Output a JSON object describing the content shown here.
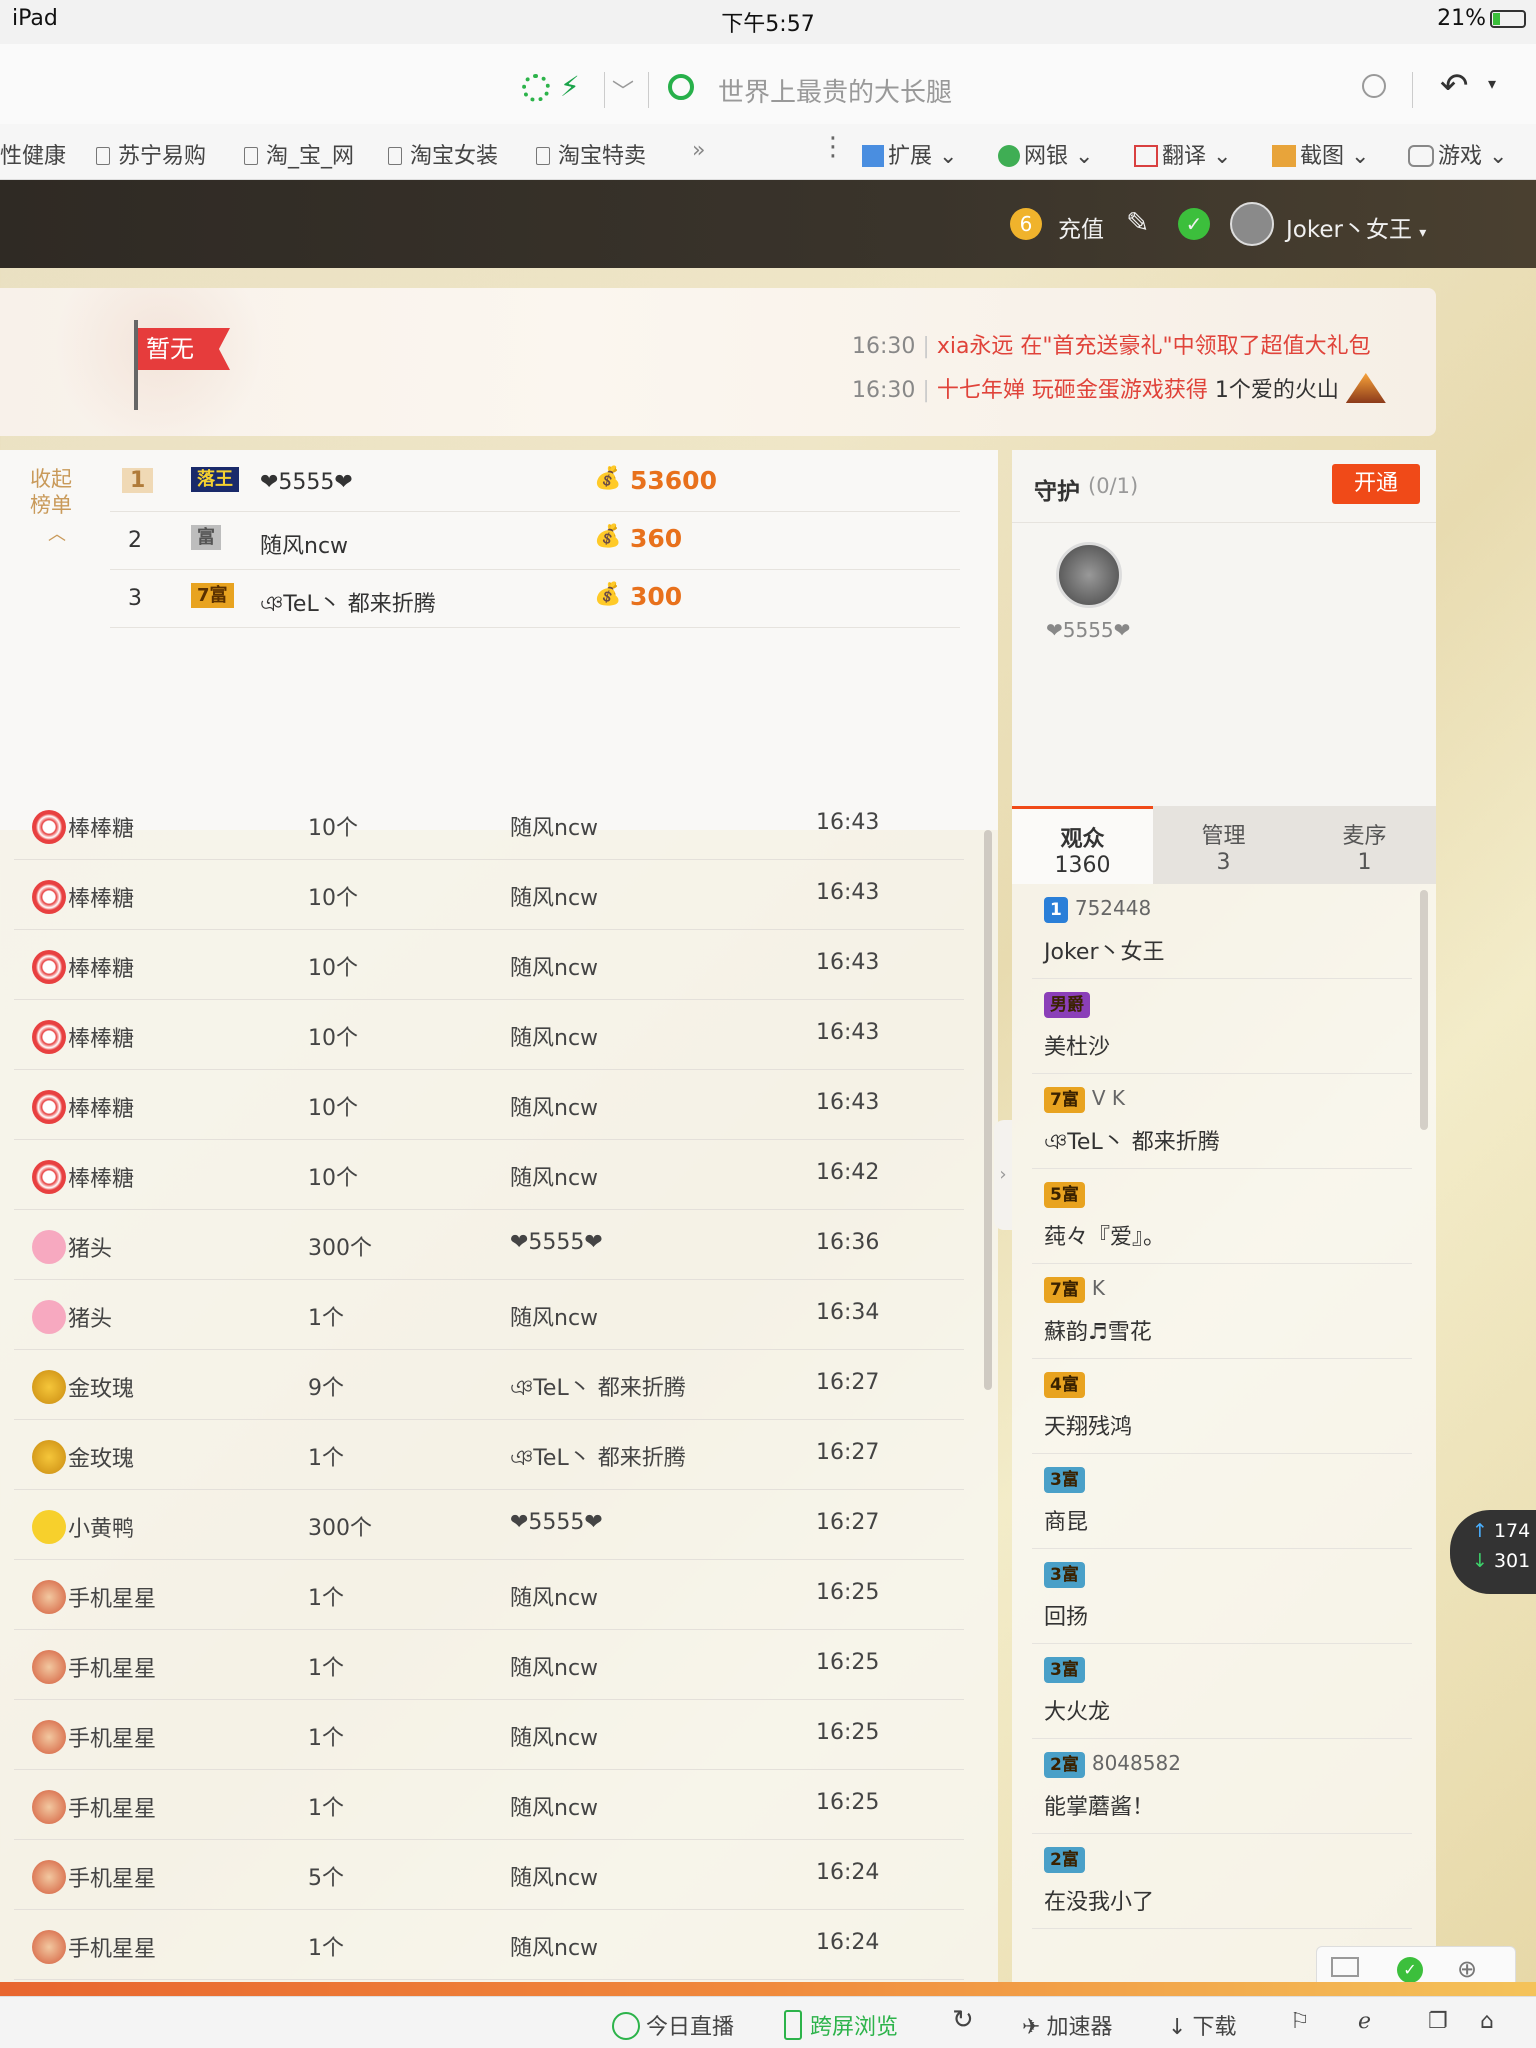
{
  "status": {
    "device": "iPad",
    "time": "下午5:57",
    "battery": "21%"
  },
  "browser": {
    "search_placeholder": "世界上最贵的大长腿",
    "bookmarks": [
      "性健康",
      "苏宁易购",
      "淘_宝_网",
      "淘宝女装",
      "淘宝特卖"
    ],
    "more": "»",
    "tools": [
      "扩展",
      "网银",
      "翻译",
      "截图",
      "游戏"
    ]
  },
  "site": {
    "recharge": "充值",
    "username": "Joker丶女王"
  },
  "banner": {
    "flag": "暂无",
    "notices": [
      {
        "time": "16:30",
        "text": "xia永远 在\"首充送豪礼\"中领取了超值大礼包"
      },
      {
        "time": "16:30",
        "user": "十七年婵",
        "text1": " 玩砸金蛋游戏获得 ",
        "text2": "1个爱的火山"
      }
    ]
  },
  "rank": {
    "collapse_label": "收起榜单",
    "rows": [
      {
        "rank": "1",
        "badge": "落王",
        "name": "❤5555❤",
        "coins": "53600"
      },
      {
        "rank": "2",
        "badge": "富",
        "name": "随风ncw",
        "coins": "360"
      },
      {
        "rank": "3",
        "badge": "7富",
        "name": "ঞTeL丶 都来折腾",
        "coins": "300"
      }
    ]
  },
  "gifts": [
    {
      "gift": "棒棒糖",
      "qty": "10个",
      "user": "随风ncw",
      "time": "16:43",
      "icon": "lollipop"
    },
    {
      "gift": "棒棒糖",
      "qty": "10个",
      "user": "随风ncw",
      "time": "16:43",
      "icon": "lollipop"
    },
    {
      "gift": "棒棒糖",
      "qty": "10个",
      "user": "随风ncw",
      "time": "16:43",
      "icon": "lollipop"
    },
    {
      "gift": "棒棒糖",
      "qty": "10个",
      "user": "随风ncw",
      "time": "16:43",
      "icon": "lollipop"
    },
    {
      "gift": "棒棒糖",
      "qty": "10个",
      "user": "随风ncw",
      "time": "16:43",
      "icon": "lollipop"
    },
    {
      "gift": "棒棒糖",
      "qty": "10个",
      "user": "随风ncw",
      "time": "16:42",
      "icon": "lollipop"
    },
    {
      "gift": "猪头",
      "qty": "300个",
      "user": "❤5555❤",
      "time": "16:36",
      "icon": "pig"
    },
    {
      "gift": "猪头",
      "qty": "1个",
      "user": "随风ncw",
      "time": "16:34",
      "icon": "pig"
    },
    {
      "gift": "金玫瑰",
      "qty": "9个",
      "user": "ঞTeL丶 都来折腾",
      "time": "16:27",
      "icon": "rose"
    },
    {
      "gift": "金玫瑰",
      "qty": "1个",
      "user": "ঞTeL丶 都来折腾",
      "time": "16:27",
      "icon": "rose"
    },
    {
      "gift": "小黄鸭",
      "qty": "300个",
      "user": "❤5555❤",
      "time": "16:27",
      "icon": "duck"
    },
    {
      "gift": "手机星星",
      "qty": "1个",
      "user": "随风ncw",
      "time": "16:25",
      "icon": "star"
    },
    {
      "gift": "手机星星",
      "qty": "1个",
      "user": "随风ncw",
      "time": "16:25",
      "icon": "star"
    },
    {
      "gift": "手机星星",
      "qty": "1个",
      "user": "随风ncw",
      "time": "16:25",
      "icon": "star"
    },
    {
      "gift": "手机星星",
      "qty": "1个",
      "user": "随风ncw",
      "time": "16:25",
      "icon": "star"
    },
    {
      "gift": "手机星星",
      "qty": "5个",
      "user": "随风ncw",
      "time": "16:24",
      "icon": "star"
    },
    {
      "gift": "手机星星",
      "qty": "1个",
      "user": "随风ncw",
      "time": "16:24",
      "icon": "star"
    }
  ],
  "guard": {
    "title": "守护",
    "count": "(0/1)",
    "open_button": "开通",
    "member": "❤5555❤"
  },
  "tabs": [
    {
      "label": "观众",
      "count": "1360"
    },
    {
      "label": "管理",
      "count": "3"
    },
    {
      "label": "麦序",
      "count": "1"
    }
  ],
  "audience": [
    {
      "badge": "1",
      "extra": "752448",
      "name": "Joker丶女王",
      "badge_color": "#2a7fd8"
    },
    {
      "badge": "男爵",
      "extra": "",
      "name": "美杜沙",
      "badge_color": "#8b3fb8"
    },
    {
      "badge": "7富",
      "extra": "V K",
      "name": "ঞTeL丶 都来折腾",
      "badge_color": "#e8a320"
    },
    {
      "badge": "5富",
      "extra": "",
      "name": "莼々『爱』。",
      "badge_color": "#e8a320"
    },
    {
      "badge": "7富",
      "extra": "K",
      "name": "蘇韵♬雪花",
      "badge_color": "#e8a320"
    },
    {
      "badge": "4富",
      "extra": "",
      "name": "天翔残鸿",
      "badge_color": "#e8a320"
    },
    {
      "badge": "3富",
      "extra": "",
      "name": "商昆",
      "badge_color": "#4aa0c8"
    },
    {
      "badge": "3富",
      "extra": "",
      "name": "回扬",
      "badge_color": "#4aa0c8"
    },
    {
      "badge": "3富",
      "extra": "",
      "name": "大火龙",
      "badge_color": "#4aa0c8"
    },
    {
      "badge": "2富",
      "extra": "8048582",
      "name": "能掌蘑酱！",
      "badge_color": "#4aa0c8"
    },
    {
      "badge": "2富",
      "extra": "",
      "name": "在没我小了",
      "badge_color": "#4aa0c8"
    }
  ],
  "speed": {
    "up": "174",
    "down": "301"
  },
  "bottombar": [
    "今日直播",
    "跨屏浏览",
    "加速器",
    "下载"
  ]
}
